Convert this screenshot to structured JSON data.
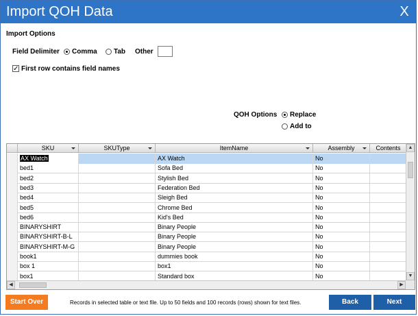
{
  "window": {
    "title": "Import QOH Data",
    "close_label": "X"
  },
  "import_options": {
    "title": "Import Options",
    "field_delimiter_label": "Field Delimiter",
    "comma_label": "Comma",
    "tab_label": "Tab",
    "other_label": "Other",
    "other_value": "",
    "selected_delimiter": "Comma",
    "first_row_label": "First row contains field names",
    "first_row_checked": true
  },
  "qoh_options": {
    "label": "QOH Options",
    "replace_label": "Replace",
    "add_to_label": "Add to",
    "selected": "Replace"
  },
  "grid": {
    "columns": [
      "SKU",
      "SKUType",
      "ItemName",
      "Assembly",
      "Contents"
    ],
    "rows": [
      [
        "AX Watch",
        "",
        "AX Watch",
        "No",
        ""
      ],
      [
        "bed1",
        "",
        "Sofa Bed",
        "No",
        ""
      ],
      [
        "bed2",
        "",
        "Stylish Bed",
        "No",
        ""
      ],
      [
        "bed3",
        "",
        "Federation Bed",
        "No",
        ""
      ],
      [
        "bed4",
        "",
        "Sleigh Bed",
        "No",
        ""
      ],
      [
        "bed5",
        "",
        "Chrome Bed",
        "No",
        ""
      ],
      [
        "bed6",
        "",
        "Kid's Bed",
        "No",
        ""
      ],
      [
        "BINARYSHIRT",
        "",
        "Binary People",
        "No",
        ""
      ],
      [
        "BINARYSHIRT-B-L",
        "",
        "Binary People",
        "No",
        ""
      ],
      [
        "BINARYSHIRT-M-G",
        "",
        "Binary People",
        "No",
        ""
      ],
      [
        "book1",
        "",
        "dummies book",
        "No",
        ""
      ],
      [
        "box 1",
        "",
        "box1",
        "No",
        ""
      ],
      [
        "box1",
        "",
        "Standard box",
        "No",
        ""
      ]
    ],
    "selected_row": 0
  },
  "footer": {
    "start_over_label": "Start Over",
    "note": "Records in selected table or text file. Up to 50 fields and 100 records (rows) shown for text files.",
    "back_label": "Back",
    "next_label": "Next"
  },
  "colors": {
    "title_bar": "#2E75C7",
    "start_over": "#F47B20",
    "nav_button": "#1F5FA8",
    "selection": "#BCD7F3"
  }
}
